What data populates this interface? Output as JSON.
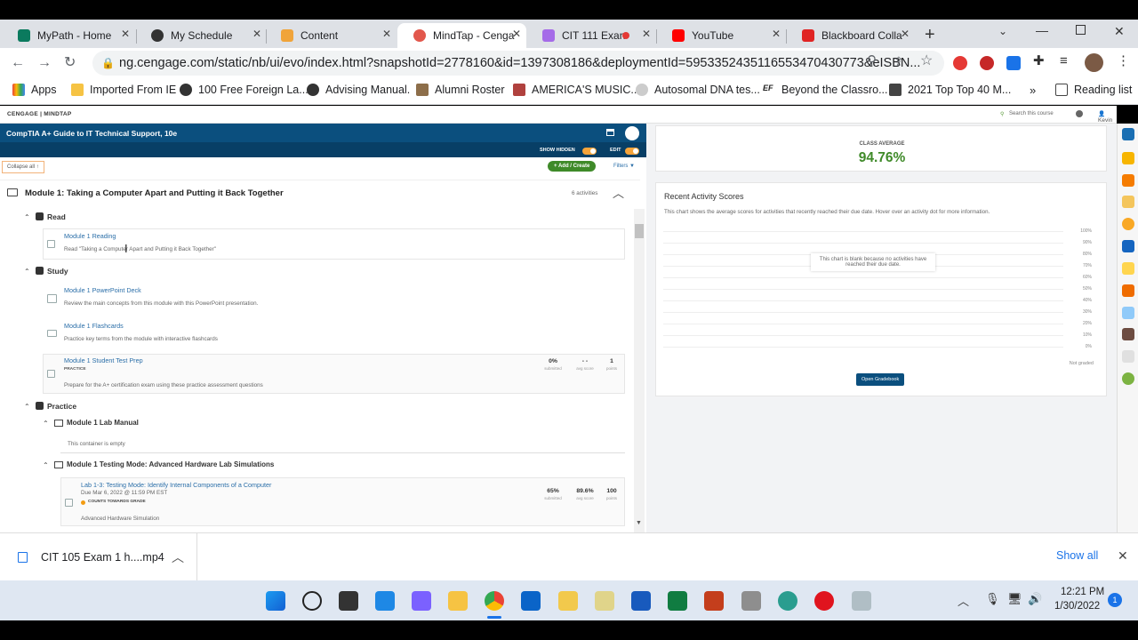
{
  "tabs": [
    {
      "label": "MyPath - Home",
      "color": "#0b7a5e"
    },
    {
      "label": "My Schedule",
      "color": "#333"
    },
    {
      "label": "Content",
      "color": "#f0a43a"
    },
    {
      "label": "MindTap - Cenga",
      "color": "#e2574c"
    },
    {
      "label": "CIT 111 Exan",
      "color": "#a56be8"
    },
    {
      "label": "YouTube",
      "color": "#ff0000"
    },
    {
      "label": "Blackboard Colla",
      "color": "#e02424"
    }
  ],
  "address": "ng.cengage.com/static/nb/ui/evo/index.html?snapshotId=2778160&id=1397308186&deploymentId=5953352435116553470430773&eISBN...",
  "bookmarks": [
    "Apps",
    "Imported From IE",
    "100 Free Foreign La...",
    "Advising Manual.",
    "Alumni Roster",
    "AMERICA'S MUSIC...",
    "Autosomal DNA tes...",
    "Beyond the Classro...",
    "2021 Top Top 40 M...",
    "Reading list"
  ],
  "cengage": {
    "brand": "CENGAGE | MINDTAP",
    "search": "Search this course",
    "user": "Kevin"
  },
  "course": {
    "title": "CompTIA A+ Guide to IT Technical Support, 10e",
    "show_hidden": "SHOW HIDDEN",
    "edit": "EDIT",
    "add_create": "+ Add / Create",
    "filters": "Filters",
    "collapse": "Collapse all"
  },
  "module": {
    "title": "Module 1: Taking a Computer Apart and Putting it Back Together",
    "count": "6 activities"
  },
  "read": {
    "label": "Read",
    "item": "Module 1 Reading",
    "desc": "Read \"Taking a Computer Apart and Putting it Back Together\""
  },
  "study": {
    "label": "Study",
    "ppt": "Module 1 PowerPoint Deck",
    "ppt_desc": "Review the main concepts from this module with this PowerPoint presentation.",
    "flash": "Module 1 Flashcards",
    "flash_desc": "Practice key terms from the module with interactive flashcards",
    "prep": "Module 1 Student Test Prep",
    "prep_tag": "PRACTICE",
    "prep_desc": "Prepare for the A+ certification exam using these practice assessment questions",
    "prep_stats": [
      {
        "v": "0%",
        "l": "submitted"
      },
      {
        "v": "- -",
        "l": "avg score"
      },
      {
        "v": "1",
        "l": "points"
      }
    ]
  },
  "practice": {
    "label": "Practice",
    "lab_manual": "Module 1 Lab Manual",
    "empty": "This container is empty",
    "testing": "Module 1 Testing Mode: Advanced Hardware Lab Simulations",
    "lab": "Lab 1-3: Testing Mode: Identify Internal Components of a Computer",
    "due": "Due Mar 6, 2022 @ 11:59 PM EST",
    "counts": "COUNTS TOWARDS GRADE",
    "lab_desc": "Advanced Hardware Simulation",
    "lab_stats": [
      {
        "v": "65%",
        "l": "submitted"
      },
      {
        "v": "89.6%",
        "l": "avg score"
      },
      {
        "v": "100",
        "l": "points"
      }
    ]
  },
  "class_avg": {
    "label": "CLASS AVERAGE",
    "value": "94.76%"
  },
  "recent": {
    "title": "Recent Activity Scores",
    "desc": "This chart shows the average scores for activities that recently reached their due date. Hover over an activity dot for more information.",
    "blank": "This chart is blank because no activities have reached their due date.",
    "not_graded": "Not graded",
    "button": "Open Gradebook",
    "ticks": [
      "100%",
      "90%",
      "80%",
      "70%",
      "60%",
      "50%",
      "40%",
      "30%",
      "20%",
      "10%",
      "0%"
    ]
  },
  "download": {
    "file": "CIT 105 Exam 1 h....mp4",
    "show_all": "Show all"
  },
  "clock": {
    "time": "12:21 PM",
    "date": "1/30/2022",
    "badge": "1"
  }
}
